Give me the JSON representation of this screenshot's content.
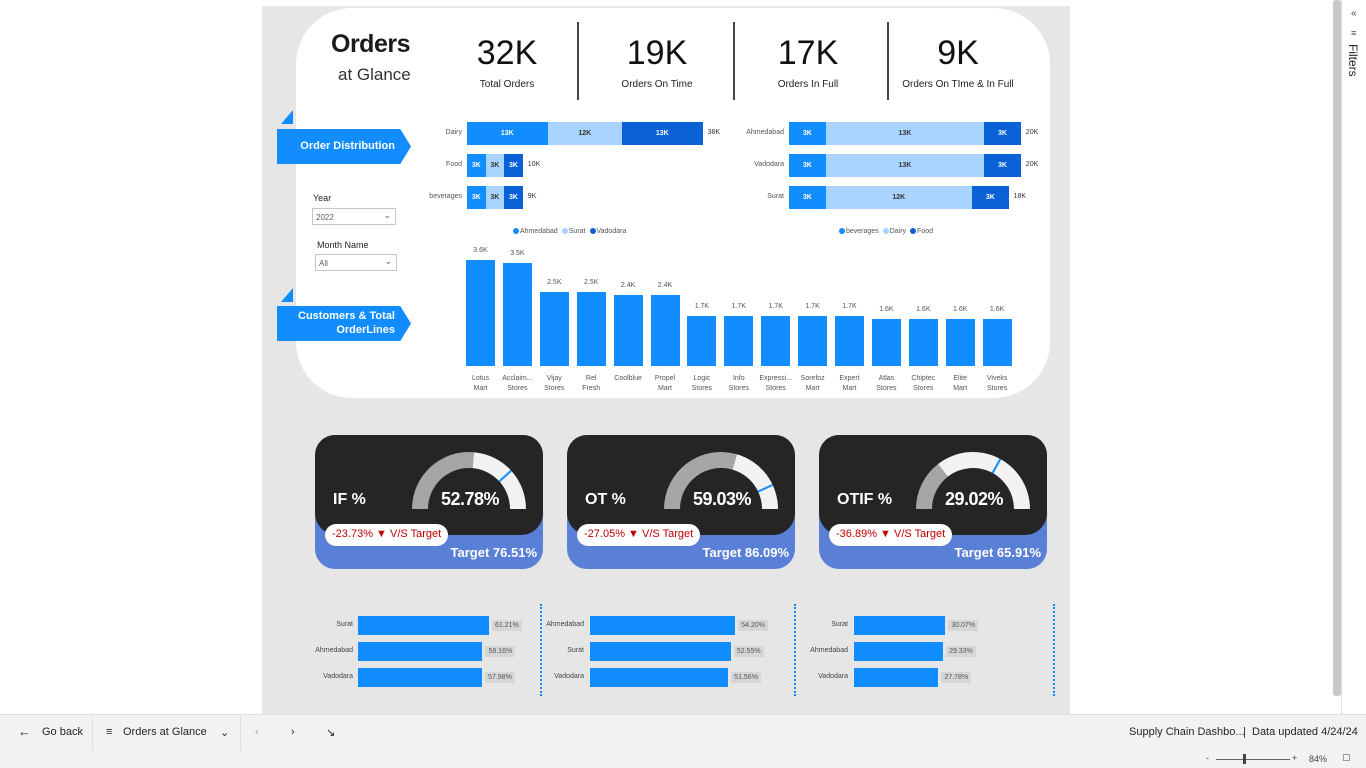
{
  "header": {
    "title": "Orders",
    "subtitle": "at Glance"
  },
  "kpis": [
    {
      "value": "32K",
      "label": "Total Orders"
    },
    {
      "value": "19K",
      "label": "Orders On Time"
    },
    {
      "value": "17K",
      "label": "Orders In Full"
    },
    {
      "value": "9K",
      "label": "Orders On TIme & In Full"
    }
  ],
  "sections": {
    "order_distribution": "Order Distribution",
    "customers": "Customers & Total OrderLines"
  },
  "slicers": {
    "year_label": "Year",
    "year_value": "2022",
    "month_label": "Month Name",
    "month_value": "All"
  },
  "chart_data": [
    {
      "type": "bar",
      "orientation": "horizontal-stacked",
      "categories": [
        "Dairy",
        "Food",
        "beverages"
      ],
      "series": [
        {
          "name": "Ahmedabad",
          "values": [
            13,
            3,
            3
          ],
          "labels": [
            "13K",
            "3K",
            "3K"
          ]
        },
        {
          "name": "Surat",
          "values": [
            12,
            3,
            3
          ],
          "labels": [
            "12K",
            "3K",
            "3K"
          ]
        },
        {
          "name": "Vadodara",
          "values": [
            13,
            3,
            3
          ],
          "labels": [
            "13K",
            "3K",
            "3K"
          ]
        }
      ],
      "totals": [
        "38K",
        "10K",
        "9K"
      ],
      "legend": [
        "Ahmedabad",
        "Surat",
        "Vadodara"
      ],
      "colors": [
        "#118dff",
        "#a9d4ff",
        "#0b62d6"
      ]
    },
    {
      "type": "bar",
      "orientation": "horizontal-stacked",
      "categories": [
        "Ahmedabad",
        "Vadodara",
        "Surat"
      ],
      "series": [
        {
          "name": "beverages",
          "values": [
            3,
            3,
            3
          ],
          "labels": [
            "3K",
            "3K",
            "3K"
          ]
        },
        {
          "name": "Dairy",
          "values": [
            13,
            13,
            12
          ],
          "labels": [
            "13K",
            "13K",
            "12K"
          ]
        },
        {
          "name": "Food",
          "values": [
            3,
            3,
            3
          ],
          "labels": [
            "3K",
            "3K",
            "3K"
          ]
        }
      ],
      "totals": [
        "20K",
        "20K",
        "18K"
      ],
      "legend": [
        "beverages",
        "Dairy",
        "Food"
      ],
      "colors": [
        "#118dff",
        "#a9d4ff",
        "#0b62d6"
      ]
    },
    {
      "type": "bar",
      "orientation": "vertical",
      "categories": [
        "Lotus Mart",
        "Acclaim... Stores",
        "Vijay Stores",
        "Rel Fresh",
        "Coolblue",
        "Propel Mart",
        "Logic Stores",
        "Info Stores",
        "Expressi... Stores",
        "Sorefoz Mart",
        "Expert Mart",
        "Atlas Stores",
        "Chiptec Stores",
        "Elite Mart",
        "Viveks Stores"
      ],
      "values": [
        3.6,
        3.5,
        2.5,
        2.5,
        2.4,
        2.4,
        1.7,
        1.7,
        1.7,
        1.7,
        1.7,
        1.6,
        1.6,
        1.6,
        1.6
      ],
      "labels": [
        "3.6K",
        "3.5K",
        "2.5K",
        "2.5K",
        "2.4K",
        "2.4K",
        "1.7K",
        "1.7K",
        "1.7K",
        "1.7K",
        "1.7K",
        "1.6K",
        "1.6K",
        "1.6K",
        "1.6K"
      ],
      "ylim": [
        0,
        3.6
      ]
    },
    {
      "type": "bar",
      "orientation": "horizontal",
      "categories": [
        "Surat",
        "Ahmedabad",
        "Vadodara"
      ],
      "values": [
        61.21,
        58.16,
        57.98
      ],
      "labels": [
        "61.21%",
        "58.16%",
        "57.98%"
      ]
    },
    {
      "type": "bar",
      "orientation": "horizontal",
      "categories": [
        "Ahmedabad",
        "Surat",
        "Vadodara"
      ],
      "values": [
        54.2,
        52.55,
        51.56
      ],
      "labels": [
        "54.20%",
        "52.55%",
        "51.56%"
      ]
    },
    {
      "type": "bar",
      "orientation": "horizontal",
      "categories": [
        "Surat",
        "Ahmedabad",
        "Vadodara"
      ],
      "values": [
        30.07,
        29.33,
        27.78
      ],
      "labels": [
        "30.07%",
        "29.33%",
        "27.78%"
      ]
    }
  ],
  "gauges": [
    {
      "name": "IF %",
      "value": "52.78%",
      "fraction": 0.5278,
      "target_fraction": 0.7651,
      "diff": "-23.73%",
      "vs": "V/S Target",
      "target_label": "Target",
      "target_value": "76.51%"
    },
    {
      "name": "OT %",
      "value": "59.03%",
      "fraction": 0.5903,
      "target_fraction": 0.8609,
      "diff": "-27.05%",
      "vs": "V/S Target",
      "target_label": "Target",
      "target_value": "86.09%"
    },
    {
      "name": "OTIF %",
      "value": "29.02%",
      "fraction": 0.2902,
      "target_fraction": 0.6591,
      "diff": "-36.89%",
      "vs": "V/S Target",
      "target_label": "Target",
      "target_value": "65.91%"
    }
  ],
  "filters_pane": {
    "label": "Filters"
  },
  "bottom_bar": {
    "go_back": "Go back",
    "page_name": "Orders at Glance",
    "report_name": "Supply Chain Dashbo...",
    "data_updated": "Data updated 4/24/24"
  },
  "status_bar": {
    "zoom": "84%"
  },
  "colors": {
    "accent": "#118dff",
    "light": "#a9d4ff",
    "dark": "#0b62d6",
    "gauge_bg": "#252525",
    "gauge_fill": "#a6a6a6",
    "target_band": "#5a7fd6",
    "negative": "#c00000"
  }
}
